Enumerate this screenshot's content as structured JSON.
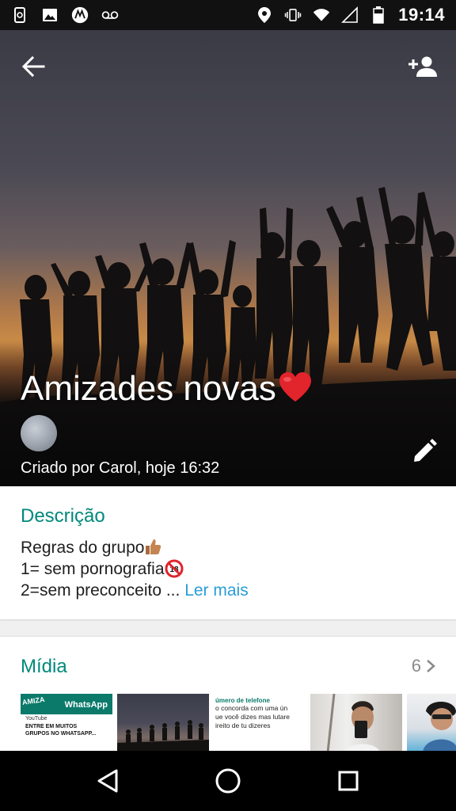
{
  "status_bar": {
    "left_icons": [
      "phone-sync-icon",
      "image-icon",
      "motorola-icon",
      "voicemail-icon"
    ],
    "right_icons": [
      "location-icon",
      "vibrate-icon",
      "wifi-icon",
      "signal-icon",
      "battery-icon"
    ],
    "time": "19:14"
  },
  "header": {
    "group_name": "Amizades novas",
    "group_name_emoji": "heart",
    "creator_emoji": "moon",
    "created_text": "Criado por Carol, hoje 16:32",
    "actions": [
      "back-arrow-icon",
      "add-person-icon",
      "edit-pencil-icon"
    ]
  },
  "description": {
    "heading": "Descrição",
    "line1": "Regras do grupo",
    "line2": "1= sem pornografia",
    "line3": "2=sem preconceito ...",
    "read_more": "Ler mais"
  },
  "media": {
    "heading": "Mídia",
    "count": "6",
    "thumbnails": [
      {
        "type": "screenshot",
        "brand": "WhatsApp",
        "banner": "AMIZA",
        "source": "YouTube",
        "lines": [
          "ENTRE EM MUITOS",
          "GRUPOS NO WHATSAPP..."
        ]
      },
      {
        "type": "photo-silhouettes"
      },
      {
        "type": "screenshot",
        "header": "úmero de telefone",
        "lines": [
          "o concorda com uma ún",
          "ue você dizes mas lutare",
          "ireito de tu dizeres"
        ]
      },
      {
        "type": "photo-selfie"
      },
      {
        "type": "photo-person"
      }
    ]
  },
  "nav_bar": {
    "buttons": [
      "back-triangle-icon",
      "home-circle-icon",
      "recents-square-icon"
    ]
  },
  "colors": {
    "accent": "#00897b",
    "link": "#2a9dd8",
    "status_bar": "#111111",
    "nav_bar": "#000000"
  }
}
